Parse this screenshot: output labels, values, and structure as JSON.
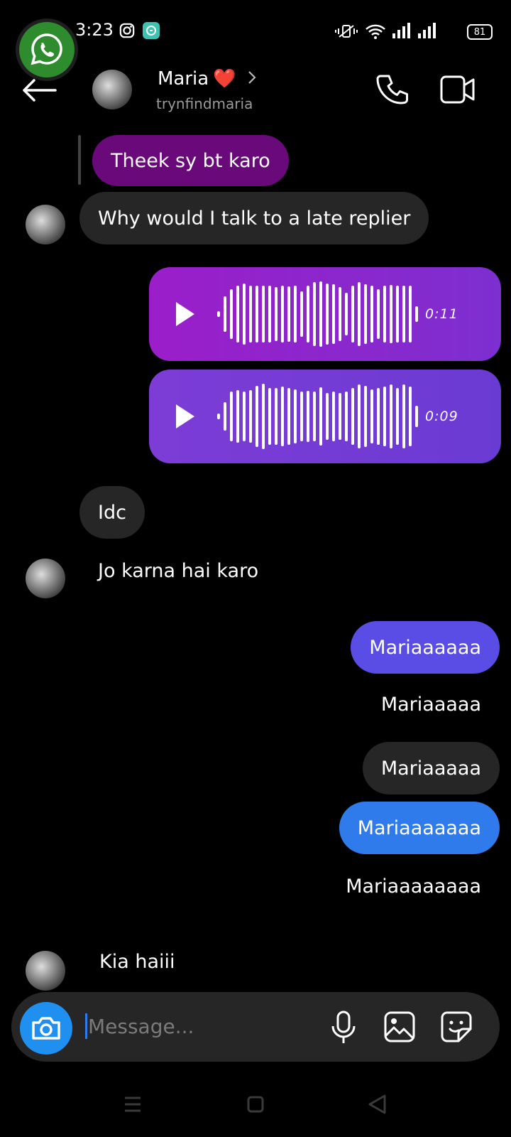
{
  "status_bar": {
    "time": "3:23",
    "battery": "81"
  },
  "header": {
    "name": "Maria",
    "heart": "❤️",
    "username": "trynfindmaria"
  },
  "messages": {
    "reply_quote": "Theek sy bt karo",
    "m1": "Why would I talk to a late replier",
    "voice1_duration": "0:11",
    "voice2_duration": "0:09",
    "m2": "Idc",
    "m3": "Jo karna hai karo",
    "m4": "Mariaaaaaa",
    "m5": "Mariaaaaa",
    "m6": "Mariaaaaa",
    "m7": "Mariaaaaaaa",
    "m8": "Mariaaaaaaaa",
    "m9": "Kia haiii"
  },
  "composer": {
    "placeholder": "Message..."
  },
  "colors": {
    "purple_reply": "#6a0a7a",
    "voice1_from": "#9b1ec9",
    "voice1_to": "#7d2fd0",
    "voice2_from": "#7d3cd6",
    "voice2_to": "#6a3bd3",
    "indigo": "#5a4de6",
    "blue": "#2f7bec",
    "gray": "#262626"
  }
}
